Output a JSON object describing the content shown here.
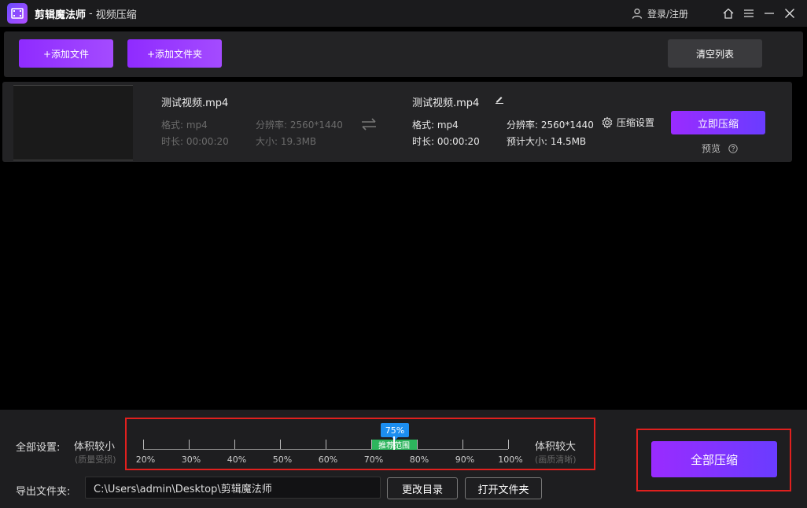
{
  "app": {
    "name": "剪辑魔法师",
    "separator": "-",
    "module": "视频压缩",
    "login": "登录/注册"
  },
  "toolbar": {
    "add_file": "+添加文件",
    "add_folder": "+添加文件夹",
    "clear_list": "清空列表"
  },
  "file": {
    "source": {
      "name": "测试视频.mp4",
      "format": "格式: mp4",
      "resolution": "分辨率: 2560*1440",
      "duration": "时长: 00:00:20",
      "size": "大小: 19.3MB"
    },
    "output": {
      "name": "测试视频.mp4",
      "format": "格式: mp4",
      "resolution": "分辨率: 2560*1440",
      "duration": "时长: 00:00:20",
      "est_size": "预计大小: 14.5MB"
    },
    "settings_label": "压缩设置",
    "compress_now": "立即压缩",
    "preview": "预览"
  },
  "bottom": {
    "all_settings": "全部设置:",
    "smaller": "体积较小",
    "smaller_sub": "(质量受损)",
    "larger": "体积较大",
    "larger_sub": "(画质清晰)",
    "slider": {
      "value": 75,
      "value_label": "75%",
      "recommended_label": "推荐范围",
      "recommended_range": [
        75,
        80
      ],
      "ticks": [
        "20%",
        "30%",
        "40%",
        "50%",
        "60%",
        "70%",
        "80%",
        "90%",
        "100%"
      ]
    },
    "export_label": "导出文件夹:",
    "export_path": "C:\\Users\\admin\\Desktop\\剪辑魔法师",
    "change_dir": "更改目录",
    "open_folder": "打开文件夹",
    "compress_all": "全部压缩"
  },
  "colors": {
    "accent_purple": "#9a2bff",
    "accent_blue": "#1c8ef0",
    "recommend_green": "#2db55d",
    "highlight_red": "#e0201e"
  }
}
